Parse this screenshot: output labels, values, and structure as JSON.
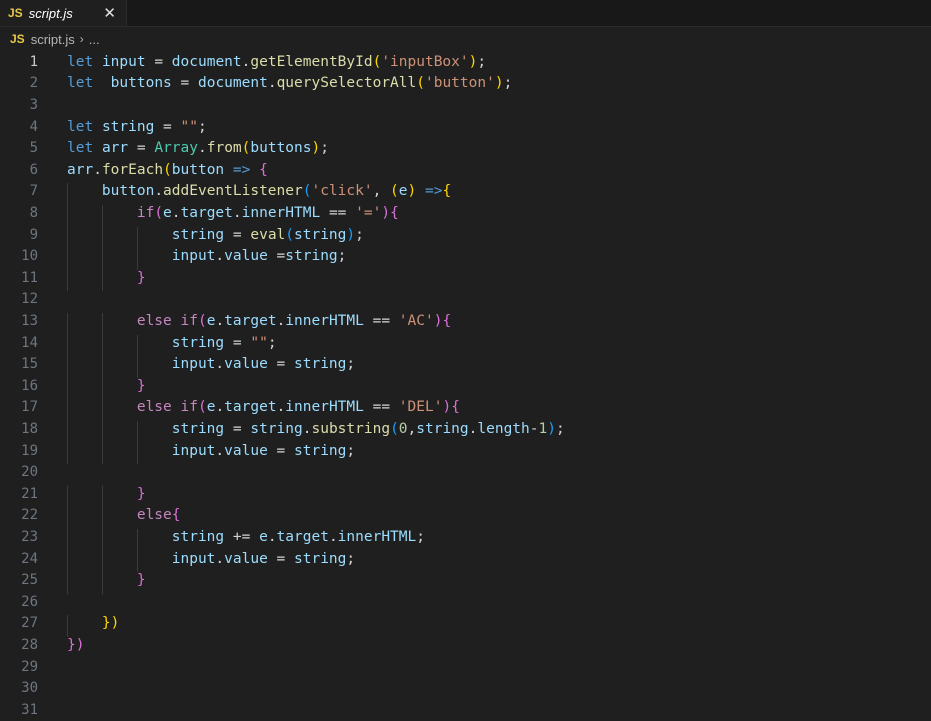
{
  "tab": {
    "badge": "JS",
    "filename": "script.js",
    "close": "✕"
  },
  "breadcrumb": {
    "badge": "JS",
    "file": "script.js",
    "separator": "›",
    "more": "..."
  },
  "active_line": 1,
  "lines": [
    {
      "n": "1",
      "indent": 0,
      "tokens": [
        [
          "let",
          "kw"
        ],
        [
          " ",
          "op"
        ],
        [
          "input",
          "var"
        ],
        [
          " = ",
          "op"
        ],
        [
          "document",
          "var"
        ],
        [
          ".",
          "op"
        ],
        [
          "getElementById",
          "fn"
        ],
        [
          "(",
          "p1"
        ],
        [
          "'inputBox'",
          "str"
        ],
        [
          ")",
          "p1"
        ],
        [
          ";",
          "op"
        ]
      ]
    },
    {
      "n": "2",
      "indent": 0,
      "tokens": [
        [
          "let",
          "kw"
        ],
        [
          "  ",
          "op"
        ],
        [
          "buttons",
          "var"
        ],
        [
          " = ",
          "op"
        ],
        [
          "document",
          "var"
        ],
        [
          ".",
          "op"
        ],
        [
          "querySelectorAll",
          "fn"
        ],
        [
          "(",
          "p1"
        ],
        [
          "'button'",
          "str"
        ],
        [
          ")",
          "p1"
        ],
        [
          ";",
          "op"
        ]
      ]
    },
    {
      "n": "3",
      "indent": 0,
      "tokens": []
    },
    {
      "n": "4",
      "indent": 0,
      "tokens": [
        [
          "let",
          "kw"
        ],
        [
          " ",
          "op"
        ],
        [
          "string",
          "var"
        ],
        [
          " = ",
          "op"
        ],
        [
          "\"\"",
          "str"
        ],
        [
          ";",
          "op"
        ]
      ]
    },
    {
      "n": "5",
      "indent": 0,
      "tokens": [
        [
          "let",
          "kw"
        ],
        [
          " ",
          "op"
        ],
        [
          "arr",
          "var"
        ],
        [
          " = ",
          "op"
        ],
        [
          "Array",
          "cls"
        ],
        [
          ".",
          "op"
        ],
        [
          "from",
          "fn"
        ],
        [
          "(",
          "p1"
        ],
        [
          "buttons",
          "var"
        ],
        [
          ")",
          "p1"
        ],
        [
          ";",
          "op"
        ]
      ]
    },
    {
      "n": "6",
      "indent": 0,
      "tokens": [
        [
          "arr",
          "var"
        ],
        [
          ".",
          "op"
        ],
        [
          "forEach",
          "fn"
        ],
        [
          "(",
          "p1"
        ],
        [
          "button",
          "var"
        ],
        [
          " ",
          "op"
        ],
        [
          "=>",
          "arrow"
        ],
        [
          " ",
          "op"
        ],
        [
          "{",
          "p2"
        ]
      ]
    },
    {
      "n": "7",
      "indent": 1,
      "tokens": [
        [
          "button",
          "var"
        ],
        [
          ".",
          "op"
        ],
        [
          "addEventListener",
          "fn"
        ],
        [
          "(",
          "p3"
        ],
        [
          "'click'",
          "str"
        ],
        [
          ", ",
          "op"
        ],
        [
          "(",
          "p1"
        ],
        [
          "e",
          "var"
        ],
        [
          ")",
          "p1"
        ],
        [
          " ",
          "op"
        ],
        [
          "=>",
          "arrow"
        ],
        [
          "{",
          "p1"
        ]
      ]
    },
    {
      "n": "8",
      "indent": 2,
      "tokens": [
        [
          "if",
          "ctl"
        ],
        [
          "(",
          "p2"
        ],
        [
          "e",
          "var"
        ],
        [
          ".",
          "op"
        ],
        [
          "target",
          "var"
        ],
        [
          ".",
          "op"
        ],
        [
          "innerHTML",
          "var"
        ],
        [
          " == ",
          "op"
        ],
        [
          "'='",
          "str"
        ],
        [
          ")",
          "p2"
        ],
        [
          "{",
          "p2"
        ]
      ]
    },
    {
      "n": "9",
      "indent": 3,
      "tokens": [
        [
          "string",
          "var"
        ],
        [
          " = ",
          "op"
        ],
        [
          "eval",
          "fn"
        ],
        [
          "(",
          "p3"
        ],
        [
          "string",
          "var"
        ],
        [
          ")",
          "p3"
        ],
        [
          ";",
          "op"
        ]
      ]
    },
    {
      "n": "10",
      "indent": 3,
      "tokens": [
        [
          "input",
          "var"
        ],
        [
          ".",
          "op"
        ],
        [
          "value",
          "var"
        ],
        [
          " =",
          "op"
        ],
        [
          "string",
          "var"
        ],
        [
          ";",
          "op"
        ]
      ]
    },
    {
      "n": "11",
      "indent": 2,
      "tokens": [
        [
          "}",
          "p2"
        ]
      ]
    },
    {
      "n": "12",
      "indent": 0,
      "tokens": []
    },
    {
      "n": "13",
      "indent": 2,
      "tokens": [
        [
          "else",
          "ctl"
        ],
        [
          " ",
          "op"
        ],
        [
          "if",
          "ctl"
        ],
        [
          "(",
          "p2"
        ],
        [
          "e",
          "var"
        ],
        [
          ".",
          "op"
        ],
        [
          "target",
          "var"
        ],
        [
          ".",
          "op"
        ],
        [
          "innerHTML",
          "var"
        ],
        [
          " == ",
          "op"
        ],
        [
          "'AC'",
          "str"
        ],
        [
          ")",
          "p2"
        ],
        [
          "{",
          "p2"
        ]
      ]
    },
    {
      "n": "14",
      "indent": 3,
      "tokens": [
        [
          "string",
          "var"
        ],
        [
          " = ",
          "op"
        ],
        [
          "\"\"",
          "str"
        ],
        [
          ";",
          "op"
        ]
      ]
    },
    {
      "n": "15",
      "indent": 3,
      "tokens": [
        [
          "input",
          "var"
        ],
        [
          ".",
          "op"
        ],
        [
          "value",
          "var"
        ],
        [
          " = ",
          "op"
        ],
        [
          "string",
          "var"
        ],
        [
          ";",
          "op"
        ]
      ]
    },
    {
      "n": "16",
      "indent": 2,
      "tokens": [
        [
          "}",
          "p2"
        ]
      ]
    },
    {
      "n": "17",
      "indent": 2,
      "tokens": [
        [
          "else",
          "ctl"
        ],
        [
          " ",
          "op"
        ],
        [
          "if",
          "ctl"
        ],
        [
          "(",
          "p2"
        ],
        [
          "e",
          "var"
        ],
        [
          ".",
          "op"
        ],
        [
          "target",
          "var"
        ],
        [
          ".",
          "op"
        ],
        [
          "innerHTML",
          "var"
        ],
        [
          " == ",
          "op"
        ],
        [
          "'DEL'",
          "str"
        ],
        [
          ")",
          "p2"
        ],
        [
          "{",
          "p2"
        ]
      ]
    },
    {
      "n": "18",
      "indent": 3,
      "tokens": [
        [
          "string",
          "var"
        ],
        [
          " = ",
          "op"
        ],
        [
          "string",
          "var"
        ],
        [
          ".",
          "op"
        ],
        [
          "substring",
          "fn"
        ],
        [
          "(",
          "p3"
        ],
        [
          "0",
          "num"
        ],
        [
          ",",
          "op"
        ],
        [
          "string",
          "var"
        ],
        [
          ".",
          "op"
        ],
        [
          "length",
          "var"
        ],
        [
          "-",
          "op"
        ],
        [
          "1",
          "num"
        ],
        [
          ")",
          "p3"
        ],
        [
          ";",
          "op"
        ]
      ]
    },
    {
      "n": "19",
      "indent": 3,
      "tokens": [
        [
          "input",
          "var"
        ],
        [
          ".",
          "op"
        ],
        [
          "value",
          "var"
        ],
        [
          " = ",
          "op"
        ],
        [
          "string",
          "var"
        ],
        [
          ";",
          "op"
        ]
      ]
    },
    {
      "n": "20",
      "indent": 0,
      "tokens": []
    },
    {
      "n": "21",
      "indent": 2,
      "tokens": [
        [
          "}",
          "p2"
        ]
      ]
    },
    {
      "n": "22",
      "indent": 2,
      "tokens": [
        [
          "else",
          "ctl"
        ],
        [
          "{",
          "p2"
        ]
      ]
    },
    {
      "n": "23",
      "indent": 3,
      "tokens": [
        [
          "string",
          "var"
        ],
        [
          " += ",
          "op"
        ],
        [
          "e",
          "var"
        ],
        [
          ".",
          "op"
        ],
        [
          "target",
          "var"
        ],
        [
          ".",
          "op"
        ],
        [
          "innerHTML",
          "var"
        ],
        [
          ";",
          "op"
        ]
      ]
    },
    {
      "n": "24",
      "indent": 3,
      "tokens": [
        [
          "input",
          "var"
        ],
        [
          ".",
          "op"
        ],
        [
          "value",
          "var"
        ],
        [
          " = ",
          "op"
        ],
        [
          "string",
          "var"
        ],
        [
          ";",
          "op"
        ]
      ]
    },
    {
      "n": "25",
      "indent": 2,
      "tokens": [
        [
          "}",
          "p2"
        ]
      ]
    },
    {
      "n": "26",
      "indent": 0,
      "tokens": []
    },
    {
      "n": "27",
      "indent": 1,
      "tokens": [
        [
          "})",
          "p1"
        ]
      ]
    },
    {
      "n": "28",
      "indent": 0,
      "tokens": [
        [
          "})",
          "p2"
        ]
      ]
    },
    {
      "n": "29",
      "indent": 0,
      "tokens": []
    },
    {
      "n": "30",
      "indent": 0,
      "tokens": []
    },
    {
      "n": "31",
      "indent": 0,
      "tokens": []
    }
  ]
}
